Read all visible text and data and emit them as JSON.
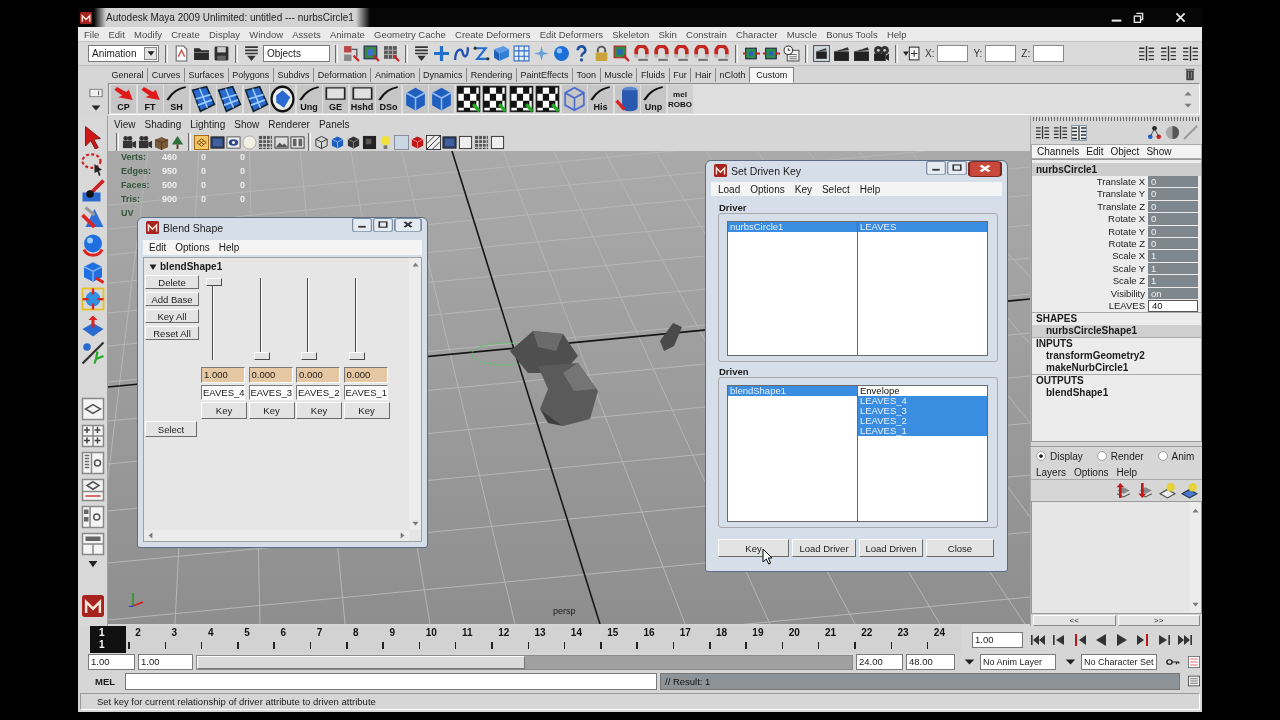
{
  "window": {
    "title": "Autodesk Maya 2009 Unlimited: untitled --- nurbsCircle1"
  },
  "menu_bar": [
    "File",
    "Edit",
    "Modify",
    "Create",
    "Display",
    "Window",
    "Assets",
    "Animate",
    "Geometry Cache",
    "Create Deformers",
    "Edit Deformers",
    "Skeleton",
    "Skin",
    "Constrain",
    "Character",
    "Muscle",
    "Bonus Tools",
    "Help"
  ],
  "status_line": {
    "menu_set": "Animation",
    "selection_mode": "Objects",
    "coordinate_fields": [
      {
        "label": "X:"
      },
      {
        "label": "Y:"
      },
      {
        "label": "Z:"
      }
    ]
  },
  "shelf": {
    "tabs": [
      {
        "label": "General",
        "selected": false
      },
      {
        "label": "Curves",
        "selected": false
      },
      {
        "label": "Surfaces",
        "selected": false
      },
      {
        "label": "Polygons",
        "selected": false
      },
      {
        "label": "Subdivs",
        "selected": false
      },
      {
        "label": "Deformation",
        "selected": false
      },
      {
        "label": "Animation",
        "selected": false
      },
      {
        "label": "Dynamics",
        "selected": false
      },
      {
        "label": "Rendering",
        "selected": false
      },
      {
        "label": "PaintEffects",
        "selected": false
      },
      {
        "label": "Toon",
        "selected": false
      },
      {
        "label": "Muscle",
        "selected": false
      },
      {
        "label": "Fluids",
        "selected": false
      },
      {
        "label": "Fur",
        "selected": false
      },
      {
        "label": "Hair",
        "selected": false
      },
      {
        "label": "nCloth",
        "selected": false
      },
      {
        "label": "Custom",
        "selected": true
      }
    ],
    "items": [
      {
        "kind": "arrow",
        "label": "CP"
      },
      {
        "kind": "arrow",
        "label": "FT"
      },
      {
        "kind": "curve",
        "label": "SH"
      },
      {
        "kind": "grid"
      },
      {
        "kind": "grid"
      },
      {
        "kind": "grid"
      },
      {
        "kind": "circle-grid"
      },
      {
        "kind": "curve",
        "label": "Ung"
      },
      {
        "kind": "frame",
        "label": "GE"
      },
      {
        "kind": "frame",
        "label": "Hshd"
      },
      {
        "kind": "curve",
        "label": "DSo"
      },
      {
        "kind": "cube"
      },
      {
        "kind": "cube"
      },
      {
        "kind": "checker"
      },
      {
        "kind": "checker"
      },
      {
        "kind": "checker"
      },
      {
        "kind": "checker"
      },
      {
        "kind": "wire-cube"
      },
      {
        "kind": "curve",
        "label": "His"
      },
      {
        "kind": "cylinder"
      },
      {
        "kind": "curve",
        "label": "Unp"
      },
      {
        "kind": "text",
        "label": "mel ROBO"
      }
    ]
  },
  "viewport": {
    "menu": [
      "View",
      "Shading",
      "Lighting",
      "Show",
      "Renderer",
      "Panels"
    ],
    "hud": [
      {
        "label": "Verts:",
        "values": [
          "460",
          "0",
          "0"
        ]
      },
      {
        "label": "Edges:",
        "values": [
          "950",
          "0",
          "0"
        ]
      },
      {
        "label": "Faces:",
        "values": [
          "500",
          "0",
          "0"
        ]
      },
      {
        "label": "Tris:",
        "values": [
          "900",
          "0",
          "0"
        ]
      },
      {
        "label": "UV"
      }
    ],
    "camera": "persp"
  },
  "blend_shape_window": {
    "title": "Blend Shape",
    "menu": [
      "Edit",
      "Options",
      "Help"
    ],
    "node": "blendShape1",
    "expanded": true,
    "buttons": [
      "Delete",
      "Add Base",
      "Key All",
      "Reset All"
    ],
    "targets": [
      {
        "level": 1,
        "value": "1.000",
        "name": "EAVES_4",
        "button": "Key"
      },
      {
        "level": 0,
        "value": "0.000",
        "name": "EAVES_3",
        "button": "Key"
      },
      {
        "level": 0,
        "value": "0.000",
        "name": "EAVES_2",
        "button": "Key"
      },
      {
        "level": 0,
        "value": "0.000",
        "name": "EAVES_1",
        "button": "Key"
      }
    ],
    "select_button": "Select"
  },
  "set_driven_key_window": {
    "title": "Set Driven Key",
    "menu": [
      "Load",
      "Options",
      "Key",
      "Select",
      "Help"
    ],
    "driver": {
      "label": "Driver",
      "objects": [
        {
          "text": "nurbsCircle1",
          "selected": true
        }
      ],
      "attributes": [
        {
          "text": "LEAVES",
          "selected": true
        }
      ]
    },
    "driven": {
      "label": "Driven",
      "objects": [
        {
          "text": "blendShape1",
          "selected": true
        }
      ],
      "attributes": [
        {
          "text": "Envelope",
          "selected": false
        },
        {
          "text": "LEAVES_4",
          "selected": true
        },
        {
          "text": "LEAVES_3",
          "selected": true
        },
        {
          "text": "LEAVES_2",
          "selected": true
        },
        {
          "text": "LEAVES_1",
          "selected": true
        }
      ]
    },
    "buttons": [
      "Key",
      "Load Driver",
      "Load Driven",
      "Close"
    ]
  },
  "channel_box": {
    "menu": [
      "Channels",
      "Edit",
      "Object",
      "Show"
    ],
    "node": "nurbsCircle1",
    "attributes": [
      {
        "name": "Translate X",
        "value": "0",
        "editing": false
      },
      {
        "name": "Translate Y",
        "value": "0",
        "editing": false
      },
      {
        "name": "Translate Z",
        "value": "0",
        "editing": false
      },
      {
        "name": "Rotate X",
        "value": "0",
        "editing": false
      },
      {
        "name": "Rotate Y",
        "value": "0",
        "editing": false
      },
      {
        "name": "Rotate Z",
        "value": "0",
        "editing": false
      },
      {
        "name": "Scale X",
        "value": "1",
        "editing": false
      },
      {
        "name": "Scale Y",
        "value": "1",
        "editing": false
      },
      {
        "name": "Scale Z",
        "value": "1",
        "editing": false
      },
      {
        "name": "Visibility",
        "value": "on",
        "editing": false
      },
      {
        "name": "LEAVES",
        "value": "40",
        "editing": true
      }
    ],
    "sections": [
      {
        "heading": "SHAPES",
        "items": [
          {
            "text": "nurbsCircleShape1",
            "selected": true
          }
        ]
      },
      {
        "heading": "INPUTS",
        "items": [
          {
            "text": "transformGeometry2",
            "selected": false
          },
          {
            "text": "makeNurbCircle1",
            "selected": false
          }
        ]
      },
      {
        "heading": "OUTPUTS",
        "items": [
          {
            "text": "blendShape1",
            "selected": false
          }
        ]
      }
    ]
  },
  "layer_editor": {
    "modes": [
      {
        "label": "Display",
        "selected": true
      },
      {
        "label": "Render",
        "selected": false
      },
      {
        "label": "Anim",
        "selected": false
      }
    ],
    "menu": [
      "Layers",
      "Options",
      "Help"
    ],
    "scroll_buttons": [
      "<<",
      ">>"
    ]
  },
  "time_slider": {
    "frames": [
      {
        "label": "1",
        "selected": true
      },
      {
        "label": "2",
        "selected": false
      },
      {
        "label": "3",
        "selected": false
      },
      {
        "label": "4",
        "selected": false
      },
      {
        "label": "5",
        "selected": false
      },
      {
        "label": "6",
        "selected": false
      },
      {
        "label": "7",
        "selected": false
      },
      {
        "label": "8",
        "selected": false
      },
      {
        "label": "9",
        "selected": false
      },
      {
        "label": "10",
        "selected": false
      },
      {
        "label": "11",
        "selected": false
      },
      {
        "label": "12",
        "selected": false
      },
      {
        "label": "13",
        "selected": false
      },
      {
        "label": "14",
        "selected": false
      },
      {
        "label": "15",
        "selected": false
      },
      {
        "label": "16",
        "selected": false
      },
      {
        "label": "17",
        "selected": false
      },
      {
        "label": "18",
        "selected": false
      },
      {
        "label": "19",
        "selected": false
      },
      {
        "label": "20",
        "selected": false
      },
      {
        "label": "21",
        "selected": false
      },
      {
        "label": "22",
        "selected": false
      },
      {
        "label": "23",
        "selected": false
      },
      {
        "label": "24",
        "selected": false
      }
    ],
    "current_frame": "1",
    "current_time": "1.00"
  },
  "range_slider": {
    "start_time": "1.00",
    "range_start": "1.00",
    "level": 0.5,
    "range_end": "24.00",
    "end_time": "48.00",
    "anim_layer": "No Anim Layer",
    "character_set": "No Character Set"
  },
  "command_line": {
    "language": "MEL",
    "result": "// Result: 1"
  },
  "help_line": "Set key for current relationship of driver attribute to driven attribute"
}
